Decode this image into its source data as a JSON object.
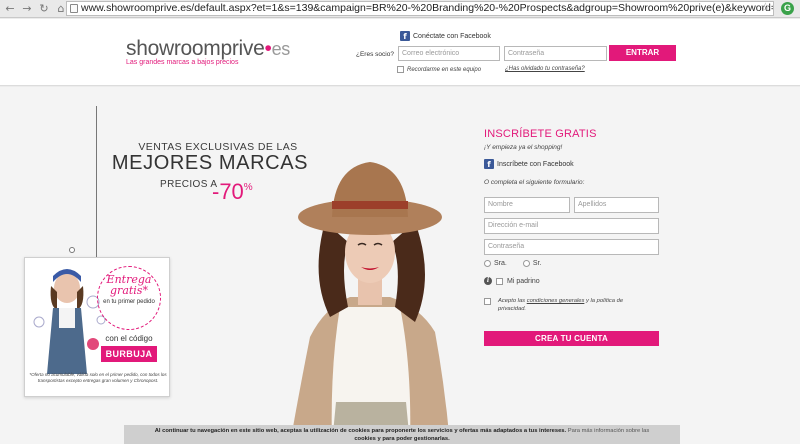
{
  "browser": {
    "back_icon": "back-arrow-icon",
    "forward_icon": "forward-arrow-icon",
    "reload_icon": "reload-icon",
    "home_icon": "home-icon",
    "url": "www.showroomprive.es/default.aspx?et=1&s=139&campaign=BR%20-%20Branding%20-%20Prospects&adgroup=Showroom%20prive(e)&keyword=e-showroom%20pri"
  },
  "header": {
    "logo_main": "showroomprive",
    "logo_dot": "•",
    "logo_es": "es",
    "tagline": "Las grandes marcas a bajos precios",
    "fb_connect": "Conéctate con Facebook",
    "socio_label": "¿Eres socio?",
    "email_placeholder": "Correo electrónico",
    "password_placeholder": "Contraseña",
    "enter_button": "ENTRAR",
    "remember_label": "Recordarme en este equipo",
    "forgot_link": "¿Has olvidado tu contraseña?"
  },
  "hero": {
    "subtitle": "VENTAS EXCLUSIVAS DE LAS",
    "title": "MEJORES MARCAS",
    "precios": "PRECIOS A",
    "discount": "-70",
    "discount_unit": "%"
  },
  "tag": {
    "entrega": "Entrega",
    "gratis": "gratis*",
    "primer": "en tu primer pedido",
    "codigo": "con el código",
    "code": "BURBUJA",
    "note": "*Oferta no acumulable, válida solo en el primer pedido, con todos los transportistas excepto entregas gran volumen y Chronopost."
  },
  "register": {
    "title": "INSCRÍBETE GRATIS",
    "subtitle": "¡Y empieza ya el shopping!",
    "fb_label": "Inscríbete con Facebook",
    "complete_label": "O completa el siguiente formulario:",
    "name_placeholder": "Nombre",
    "surname_placeholder": "Apellidos",
    "email_placeholder": "Dirección e-mail",
    "password_placeholder": "Contraseña",
    "sra_label": "Sra.",
    "sr_label": "Sr.",
    "padrino_label": "Mi padrino",
    "accept_prefix": "Acepto las ",
    "accept_link": "condiciones generales",
    "accept_suffix": " y la política de privacidad.",
    "create_button": "CREA TU CUENTA"
  },
  "cookie": {
    "text": "Al continuar tu navegación en este sitio web, aceptas la utilización de cookies para proponerte los servicios y ofertas más adaptados a tus intereses.",
    "more": "Para más información sobre las",
    "tail": "cookies y para poder gestionarlas."
  },
  "colors": {
    "accent": "#e2197a",
    "facebook": "#3b5998"
  }
}
